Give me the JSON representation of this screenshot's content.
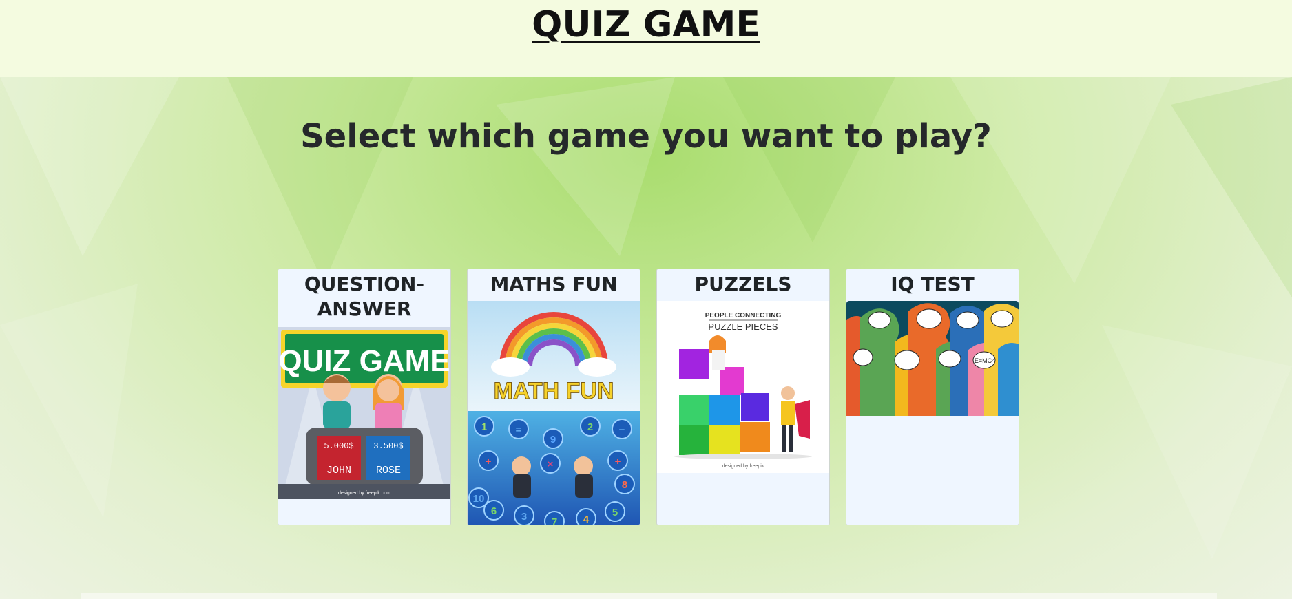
{
  "header": {
    "title": "QUIZ GAME"
  },
  "main": {
    "headline": "Select which game you want to play?"
  },
  "cards": [
    {
      "title": "QUESTION-ANSWER",
      "title_line1": "QUESTION-",
      "title_line2": "ANSWER",
      "image": {
        "banner": "QUIZ GAME",
        "score_left": "5.000$",
        "score_right": "3.500$",
        "name_left": "JOHN",
        "name_right": "ROSE",
        "credit": "designed by freepik.com"
      }
    },
    {
      "title": "MATHS FUN",
      "image": {
        "banner": "MATH FUN",
        "bubbles": [
          "1",
          "=",
          "9",
          "2",
          "−",
          "+",
          "×",
          "+",
          "10",
          "8",
          "6",
          "3",
          "7",
          "4",
          "5"
        ]
      }
    },
    {
      "title": "PUZZELS",
      "image": {
        "caption_top": "PEOPLE CONNECTING",
        "caption_bottom": "PUZZLE PIECES",
        "credit": "designed by freepik"
      }
    },
    {
      "title": "IQ TEST",
      "image": {
        "note": "E=MC²"
      }
    }
  ],
  "colors": {
    "topbar": "#f4fbe0",
    "card_bg": "#eff6ff",
    "accent_green": "#a9dd6e"
  }
}
